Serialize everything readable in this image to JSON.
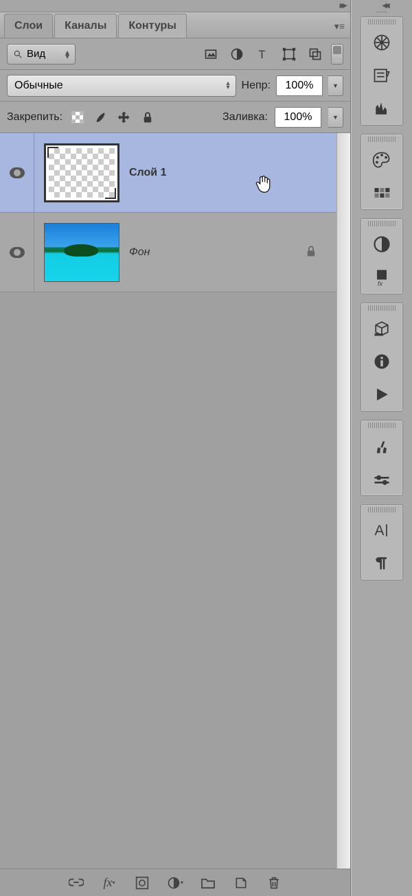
{
  "tabs": {
    "layers": "Слои",
    "channels": "Каналы",
    "paths": "Контуры"
  },
  "filter": {
    "kind": "Вид"
  },
  "blend": {
    "mode": "Обычные",
    "opacity_label": "Непр:",
    "opacity_value": "100%",
    "fill_label": "Заливка:",
    "fill_value": "100%"
  },
  "lock": {
    "label": "Закрепить:"
  },
  "layers": [
    {
      "name": "Слой 1",
      "selected": true,
      "locked": false,
      "italic": false,
      "thumb": "checker"
    },
    {
      "name": "Фон",
      "selected": false,
      "locked": true,
      "italic": true,
      "thumb": "beach"
    }
  ],
  "sidebar_icons": [
    [
      "navigator",
      "history",
      "histogram"
    ],
    [
      "color",
      "swatches"
    ],
    [
      "adjustments",
      "styles"
    ],
    [
      "3d",
      "info",
      "play"
    ],
    [
      "brushes",
      "brush-presets"
    ],
    [
      "character",
      "paragraph"
    ]
  ]
}
